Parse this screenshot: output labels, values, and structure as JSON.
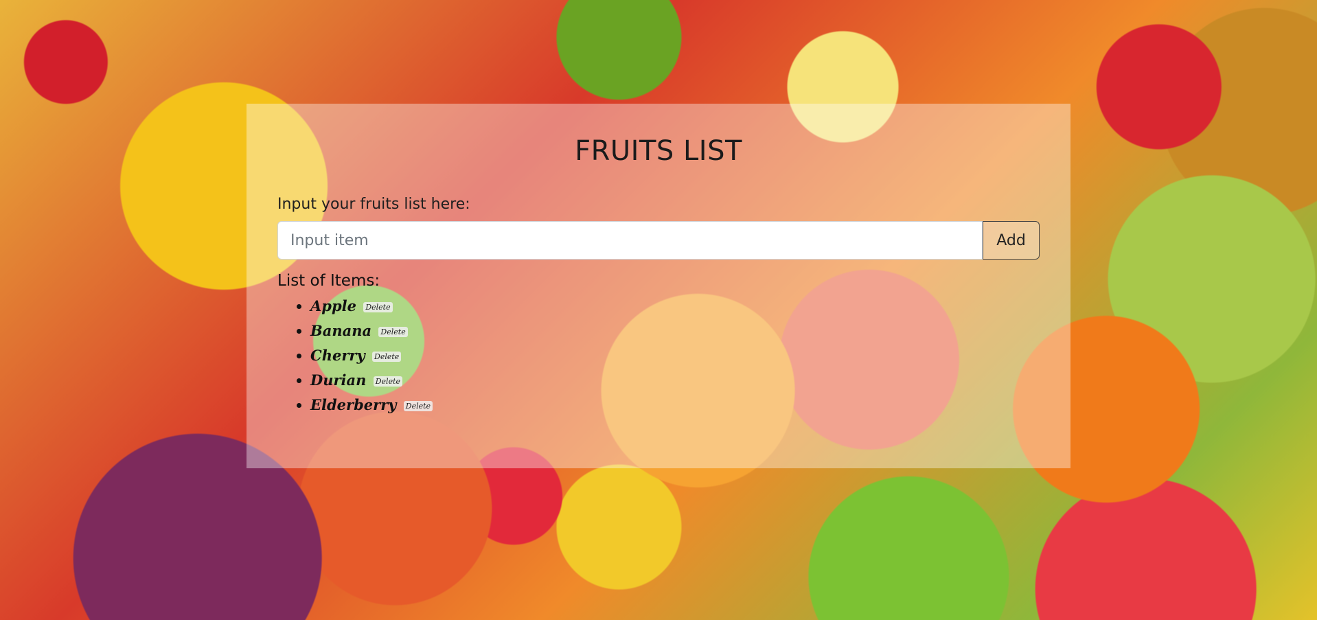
{
  "page": {
    "title": "FRUITS LIST"
  },
  "form": {
    "prompt": "Input your fruits list here:",
    "input_placeholder": "Input item",
    "add_label": "Add"
  },
  "list": {
    "heading": "List of Items:",
    "items": [
      {
        "name": "Apple",
        "delete_label": "Delete"
      },
      {
        "name": "Banana",
        "delete_label": "Delete"
      },
      {
        "name": "Cherry",
        "delete_label": "Delete"
      },
      {
        "name": "Durian",
        "delete_label": "Delete"
      },
      {
        "name": "Elderberry",
        "delete_label": "Delete"
      }
    ]
  }
}
